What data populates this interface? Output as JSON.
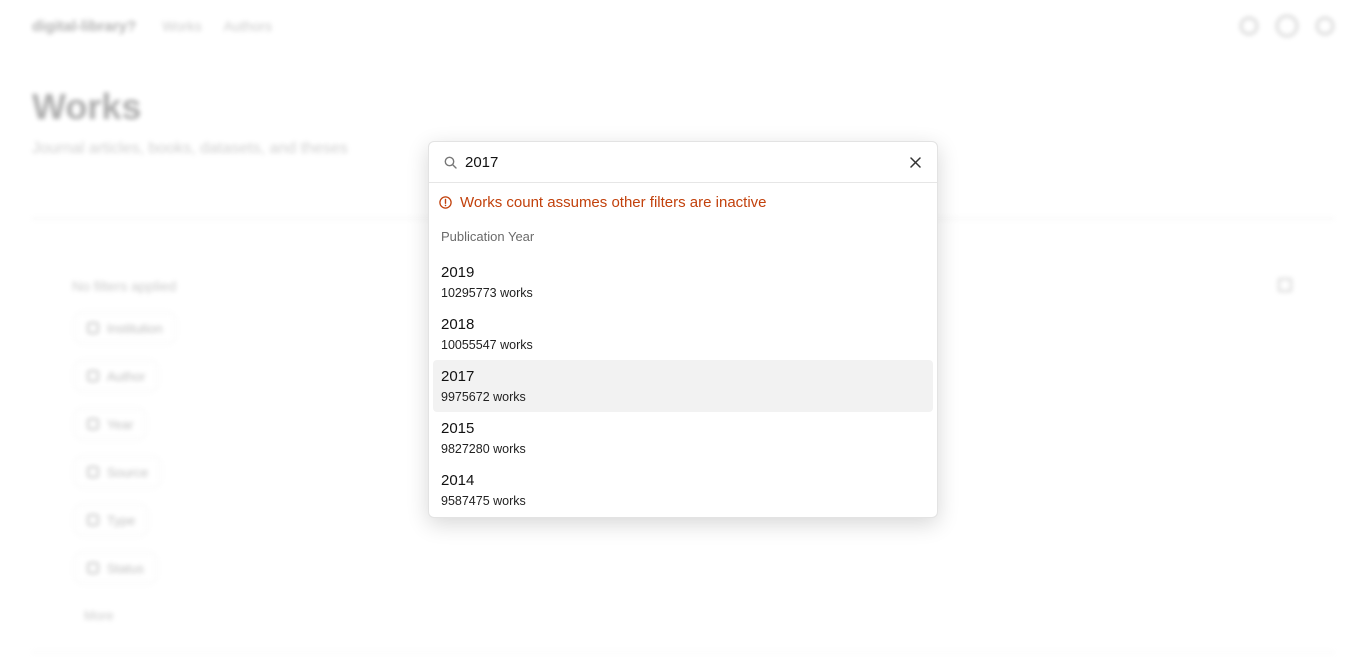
{
  "app": {
    "name": "digital-library?"
  },
  "nav": {
    "items": [
      "Works",
      "Authors"
    ]
  },
  "page": {
    "title": "Works",
    "subtitle": "Journal articles, books, datasets, and theses"
  },
  "filters": {
    "empty_label": "No filters applied",
    "chips": [
      "Institution",
      "Author",
      "Year",
      "Source",
      "Type",
      "Status"
    ],
    "more_label": "More"
  },
  "popup": {
    "search": {
      "value": "2017",
      "placeholder": "Search"
    },
    "warning": "Works count assumes other filters are inactive",
    "group_label": "Publication Year",
    "options": [
      {
        "year": "2019",
        "count": "10295773 works",
        "selected": false
      },
      {
        "year": "2018",
        "count": "10055547 works",
        "selected": false
      },
      {
        "year": "2017",
        "count": "9975672 works",
        "selected": true
      },
      {
        "year": "2015",
        "count": "9827280 works",
        "selected": false
      },
      {
        "year": "2014",
        "count": "9587475 works",
        "selected": false
      }
    ]
  },
  "colors": {
    "warning": "#c2410c",
    "selected_bg": "#f2f2f2"
  },
  "icons": {
    "search": "search-icon",
    "clear": "close-icon",
    "warning": "info-circle-icon"
  }
}
